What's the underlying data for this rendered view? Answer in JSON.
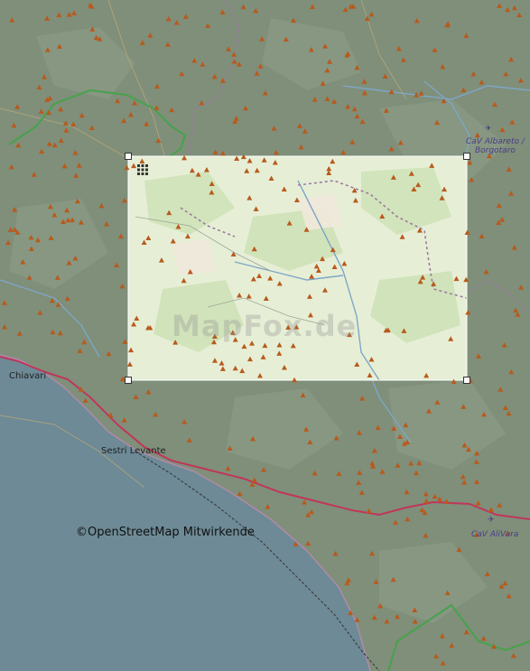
{
  "places": {
    "chiavari": "Chiavari",
    "sestri_levante": "Sestri Levante"
  },
  "airports": {
    "albareto_line1": "CaV Albareto /",
    "albareto_line2": "Borgotaro",
    "alivara": "CaV AliVara"
  },
  "attribution": "©OpenStreetMap Mitwirkende",
  "watermark": "MapFox.de",
  "colors": {
    "land_dark": "#7f8f7a",
    "sea": "#6d8a96",
    "highlight": "#e6efd6",
    "motorway": "#c0365a",
    "peak_marker": "#b85a1c",
    "border": "#9b7aa3",
    "park_border": "#47a24b"
  },
  "icons": {
    "peak": "peak-triangle-icon",
    "airport": "airplane-icon",
    "grid": "grid-icon"
  }
}
